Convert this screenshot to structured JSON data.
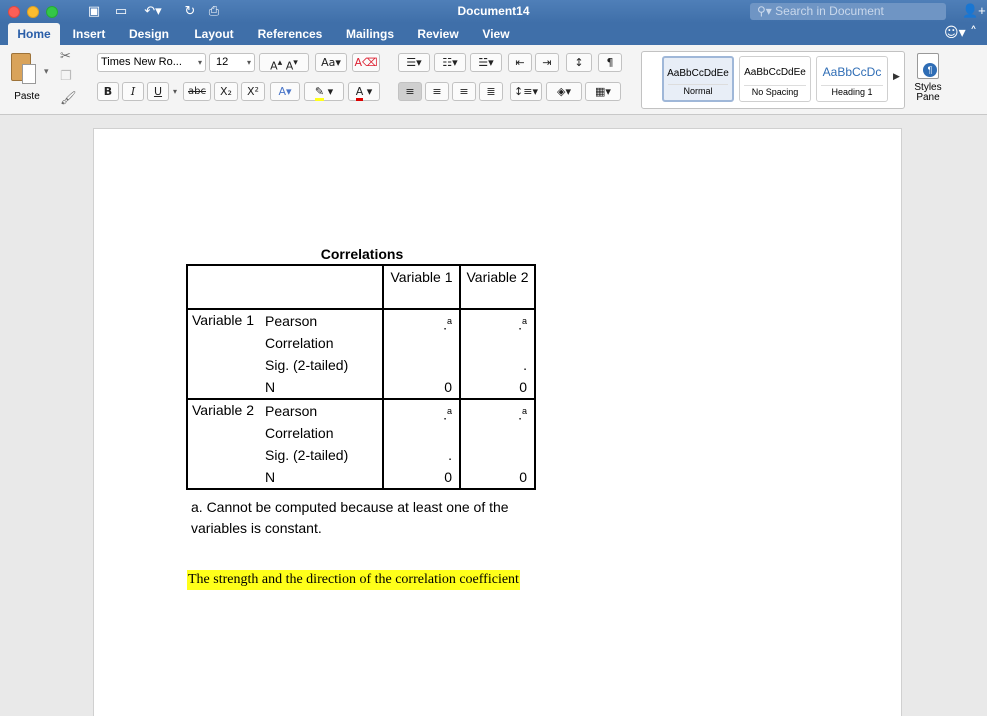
{
  "window": {
    "title": "Document14",
    "search_placeholder": "Search in Document"
  },
  "tabs": [
    "Home",
    "Insert",
    "Design",
    "Layout",
    "References",
    "Mailings",
    "Review",
    "View"
  ],
  "ribbon": {
    "paste_label": "Paste",
    "font_name": "Times New Ro...",
    "font_size": "12",
    "bold": "B",
    "italic": "I",
    "underline": "U",
    "strike": "abc",
    "subscript": "X₂",
    "superscript": "X²",
    "styles": [
      {
        "sample": "AaBbCcDdEe",
        "name": "Normal"
      },
      {
        "sample": "AaBbCcDdEe",
        "name": "No Spacing"
      },
      {
        "sample": "AaBbCcDc",
        "name": "Heading 1"
      }
    ],
    "styles_pane_label": "Styles Pane"
  },
  "document": {
    "table_title": "Correlations",
    "col_headers": [
      "Variable 1",
      "Variable 2"
    ],
    "rows": [
      {
        "label": "Variable 1",
        "pearson": "Pearson Correlation",
        "sig": "Sig. (2-tailed)",
        "n": "N",
        "v1_pearson": ".",
        "v1_pearson_sup": "a",
        "v2_pearson": ".",
        "v2_pearson_sup": "a",
        "v1_sig": "",
        "v2_sig": ".",
        "v1_n": "0",
        "v2_n": "0"
      },
      {
        "label": "Variable 2",
        "pearson": "Pearson Correlation",
        "sig": "Sig. (2-tailed)",
        "n": "N",
        "v1_pearson": ".",
        "v1_pearson_sup": "a",
        "v2_pearson": ".",
        "v2_pearson_sup": "a",
        "v1_sig": ".",
        "v2_sig": "",
        "v1_n": "0",
        "v2_n": "0"
      }
    ],
    "footnote": "a. Cannot be computed because at least one of the variables is constant.",
    "highlighted_text": "The strength and the direction of the correlation coefficient",
    "highlight_color": "#ffff1a"
  }
}
